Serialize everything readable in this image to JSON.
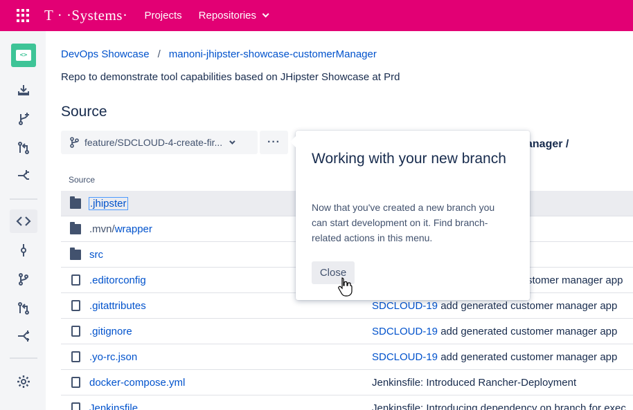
{
  "topbar": {
    "brand": "T · ·Systems·",
    "nav": [
      {
        "label": "Projects"
      },
      {
        "label": "Repositories"
      }
    ]
  },
  "sidebar": {
    "avatar_glyph": "<>",
    "icons": [
      "clone-icon",
      "branch-create-icon",
      "pull-request-icon",
      "fork-icon",
      "source-icon",
      "commits-icon",
      "branches-icon",
      "pull-requests-icon",
      "forks-icon",
      "settings-icon"
    ]
  },
  "breadcrumb": {
    "project": "DevOps Showcase",
    "separator": "/",
    "repo": "manoni-jhipster-showcase-customerManager"
  },
  "description": "Repo to demonstrate tool capabilities based on JHipster Showcase at Prd",
  "page_title": "Source",
  "branch": {
    "label": "feature/SDCLOUD-4-create-fir...",
    "more_label": "···"
  },
  "path_breadcrumb": "anager /",
  "table": {
    "column_header": "Source",
    "rows": [
      {
        "type": "folder",
        "name": ".jhipster",
        "dim_prefix": "",
        "commit_key": "",
        "commit_msg": ""
      },
      {
        "type": "folder",
        "name": "wrapper",
        "dim_prefix": ".mvn/",
        "commit_key": "",
        "commit_msg": ""
      },
      {
        "type": "folder",
        "name": "src",
        "dim_prefix": "",
        "commit_key": "",
        "commit_msg": ""
      },
      {
        "type": "file",
        "name": ".editorconfig",
        "dim_prefix": "",
        "commit_key": "",
        "commit_msg": "stomer manager app"
      },
      {
        "type": "file",
        "name": ".gitattributes",
        "dim_prefix": "",
        "commit_key": "SDCLOUD-19",
        "commit_msg": " add generated customer manager app"
      },
      {
        "type": "file",
        "name": ".gitignore",
        "dim_prefix": "",
        "commit_key": "SDCLOUD-19",
        "commit_msg": " add generated customer manager app"
      },
      {
        "type": "file",
        "name": ".yo-rc.json",
        "dim_prefix": "",
        "commit_key": "SDCLOUD-19",
        "commit_msg": " add generated customer manager app"
      },
      {
        "type": "file",
        "name": "docker-compose.yml",
        "dim_prefix": "",
        "commit_key": "",
        "commit_msg": "Jenkinsfile: Introduced Rancher-Deployment"
      },
      {
        "type": "file",
        "name": "Jenkinsfile",
        "dim_prefix": "",
        "commit_key": "",
        "commit_msg": "Jenkinsfile: Introducing dependency on branch for exec"
      }
    ]
  },
  "popup": {
    "title": "Working with your new branch",
    "body": "Now that you've created a new branch you can start development on it. Find branch-related actions in this menu.",
    "close_label": "Close"
  }
}
